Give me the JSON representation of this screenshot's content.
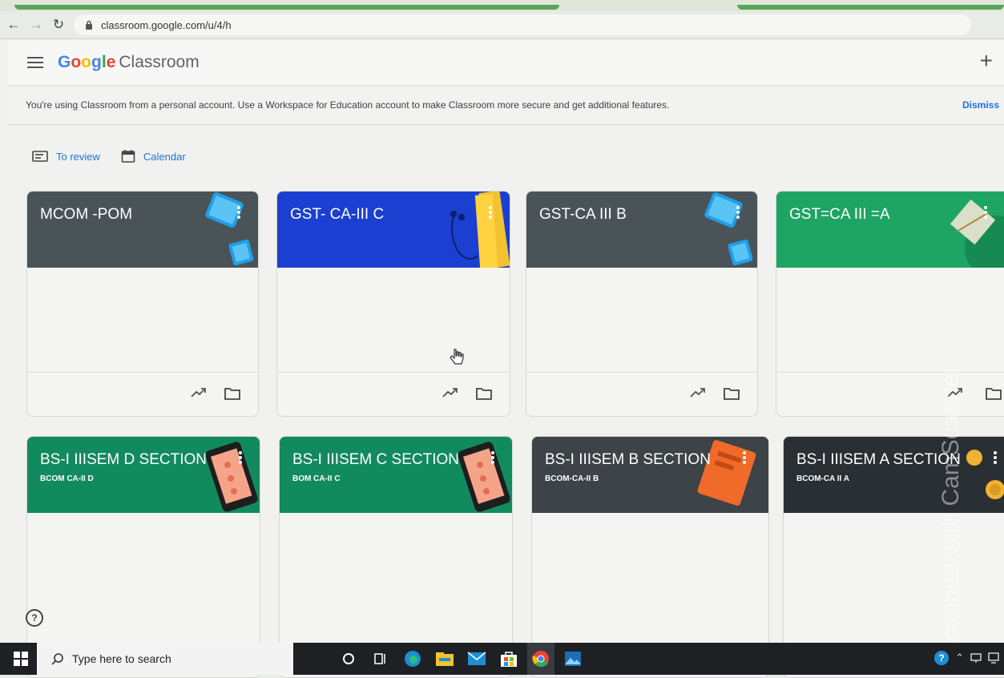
{
  "browser": {
    "url": "classroom.google.com/u/4/h"
  },
  "app": {
    "logo_google": [
      "G",
      "o",
      "o",
      "g",
      "l",
      "e"
    ],
    "logo_colors": [
      "#4285f4",
      "#ea4335",
      "#fbbc05",
      "#4285f4",
      "#34a853",
      "#ea4335"
    ],
    "product": "Classroom"
  },
  "banner": {
    "message": "You're using Classroom from a personal account. Use a Workspace for Education account to make Classroom more secure and get additional features.",
    "dismiss": "Dismiss"
  },
  "tools": {
    "to_review": "To review",
    "calendar": "Calendar"
  },
  "classes": [
    {
      "title": "MCOM -POM",
      "subtitle": "",
      "color": "#4a5458"
    },
    {
      "title": "GST- CA-III C",
      "subtitle": "",
      "color": "#1a3fd1"
    },
    {
      "title": "GST-CA III B",
      "subtitle": "",
      "color": "#4a5458"
    },
    {
      "title": "GST=CA III =A",
      "subtitle": "",
      "color": "#1ea463"
    },
    {
      "title": "BS-I IIISEM D SECTION",
      "subtitle": "BCOM CA-II D",
      "color": "#128a5f"
    },
    {
      "title": "BS-I IIISEM C SECTION",
      "subtitle": "BOM CA-II C",
      "color": "#128a5f"
    },
    {
      "title": "BS-I IIISEM B SECTION",
      "subtitle": "BCOM-CA-II B",
      "color": "#3d4347"
    },
    {
      "title": "BS-I IIISEM A SECTION",
      "subtitle": "BCOM-CA II A",
      "color": "#2a2f33"
    }
  ],
  "taskbar": {
    "search_placeholder": "Type here to search"
  },
  "watermark": "Scanned with CamScanner"
}
